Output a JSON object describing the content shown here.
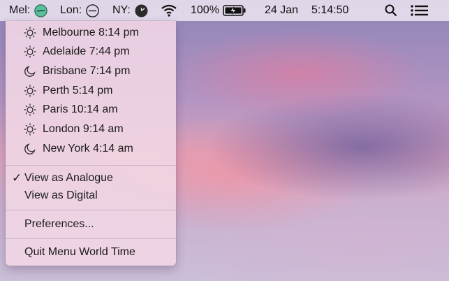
{
  "menubar": {
    "mel_label": "Mel:",
    "lon_label": "Lon:",
    "ny_label": "NY:",
    "battery_percent": "100%",
    "date": "24 Jan",
    "time": "5:14:50"
  },
  "menu": {
    "cities": [
      {
        "label": "Melbourne 8:14 pm",
        "icon": "sun-icon"
      },
      {
        "label": "Adelaide 7:44 pm",
        "icon": "sun-icon"
      },
      {
        "label": "Brisbane 7:14 pm",
        "icon": "moon-icon"
      },
      {
        "label": "Perth 5:14 pm",
        "icon": "sun-icon"
      },
      {
        "label": "Paris 10:14 am",
        "icon": "sun-icon"
      },
      {
        "label": "London 9:14 am",
        "icon": "sun-icon"
      },
      {
        "label": "New York 4:14 am",
        "icon": "moon-icon"
      }
    ],
    "view_analogue": "View as Analogue",
    "view_analogue_checked": "✓",
    "view_digital": "View as Digital",
    "preferences": "Preferences...",
    "quit": "Quit Menu World Time"
  },
  "colors": {
    "mel_clock": "#5bbf9a",
    "ny_clock": "#2b2b2b"
  }
}
